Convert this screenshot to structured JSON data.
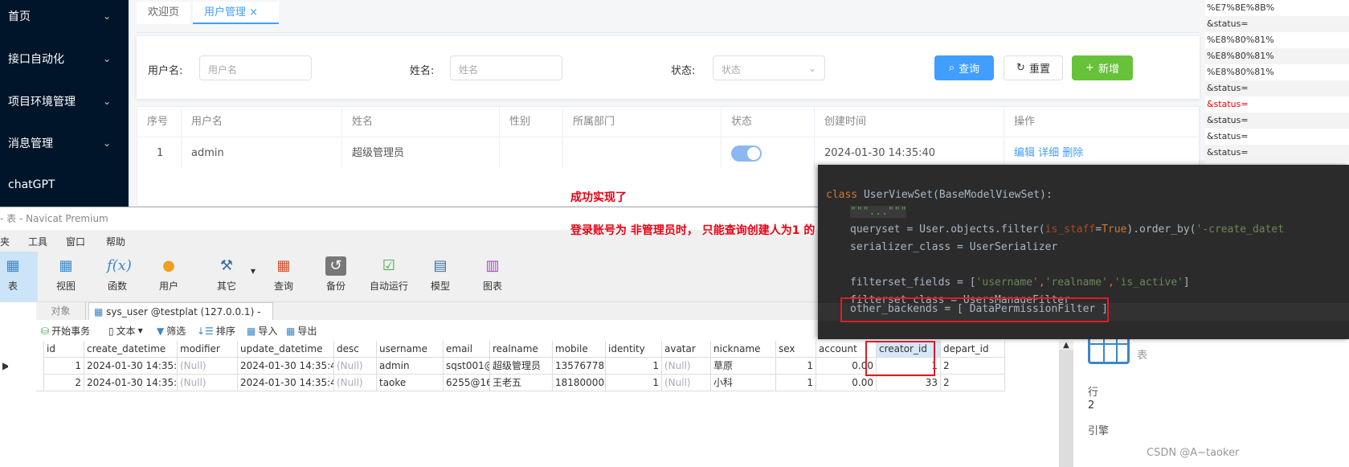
{
  "sidebar": {
    "items": [
      {
        "label": "首页"
      },
      {
        "label": "接口自动化"
      },
      {
        "label": "项目环境管理"
      },
      {
        "label": "消息管理"
      },
      {
        "label": "chatGPT"
      }
    ]
  },
  "web": {
    "tabs": [
      {
        "label": "欢迎页"
      },
      {
        "label": "用户管理",
        "close": "×"
      }
    ],
    "search": {
      "username_label": "用户名:",
      "username_placeholder": "用户名",
      "realname_label": "姓名:",
      "realname_placeholder": "姓名",
      "status_label": "状态:",
      "status_placeholder": "状态",
      "query": "查询",
      "reset": "重置",
      "add": "新增"
    },
    "table": {
      "headers": [
        "序号",
        "用户名",
        "姓名",
        "性别",
        "所属部门",
        "状态",
        "创建时间",
        "操作"
      ],
      "rows": [
        {
          "index": "1",
          "username": "admin",
          "realname": "超级管理员",
          "gender": "",
          "dept": "",
          "status_on": true,
          "created": "2024-01-30 14:35:40",
          "actions": [
            "编辑",
            "详细",
            "删除"
          ]
        }
      ]
    },
    "colors": {
      "primary": "#409eff",
      "success": "#67c23a"
    }
  },
  "url_log": [
    "%E7%8E%8B%",
    "&status=",
    "%E8%80%81%",
    "%E8%80%81%",
    "%E8%80%81%",
    "&status=",
    "&status=",
    "&status=",
    "&status=",
    "&status="
  ],
  "annotations": {
    "line1": "成功实现了",
    "line2": "登录账号为 非管理员时， 只能查询创建人为1 的"
  },
  "navicat": {
    "title": "- 表 - Navicat Premium",
    "menu": [
      "夹",
      "工具",
      "窗口",
      "帮助"
    ],
    "toolbar": [
      {
        "label": "表",
        "icon": "table-icon"
      },
      {
        "label": "视图",
        "icon": "view-icon"
      },
      {
        "label": "函数",
        "icon": "function-icon"
      },
      {
        "label": "用户",
        "icon": "user-icon"
      },
      {
        "label": "其它",
        "icon": "tools-icon"
      },
      {
        "label": "查询",
        "icon": "query-icon"
      },
      {
        "label": "备份",
        "icon": "backup-icon"
      },
      {
        "label": "自动运行",
        "icon": "schedule-icon"
      },
      {
        "label": "模型",
        "icon": "model-icon"
      },
      {
        "label": "图表",
        "icon": "chart-icon"
      }
    ],
    "tabs": {
      "objects": "对象",
      "table_tab": "sys_user @testplat (127.0.0.1) - 表"
    },
    "subtoolbar": {
      "begin_tx": "开始事务",
      "text": "文本",
      "filter": "筛选",
      "sort": "排序",
      "import": "导入",
      "export": "导出"
    },
    "grid": {
      "columns": [
        "id",
        "create_datetime",
        "modifier",
        "update_datetime",
        "desc",
        "username",
        "email",
        "realname",
        "mobile",
        "identity",
        "avatar",
        "nickname",
        "sex",
        "account",
        "creator_id",
        "depart_id"
      ],
      "rows": [
        [
          "1",
          "2024-01-30 14:35:40.",
          "(Null)",
          "2024-01-30 14:35:40.4",
          "(Null)",
          "admin",
          "sqst001@",
          "超级管理员",
          "1357677800",
          "1",
          "(Null)",
          "草原",
          "1",
          "0.00",
          "1",
          "2"
        ],
        [
          "2",
          "2024-01-30 14:35:40.",
          "(Null)",
          "2024-01-30 14:35:40.4",
          "(Null)",
          "taoke",
          "6255@163",
          "王老五",
          "1818000000",
          "1",
          "(Null)",
          "小科",
          "1",
          "0.00",
          "33",
          "2"
        ]
      ]
    },
    "info": {
      "type": "表",
      "rows_label": "行",
      "rows_value": "2",
      "engine_label": "引擎"
    }
  },
  "code": {
    "l1_kw": "class ",
    "l1_rest": "UserViewSet(BaseModelViewSet):",
    "l2": "\"\"\"...\"\"\"",
    "l3a": "queryset = User.objects.filter(",
    "l3b": "is_staff",
    "l3c": "=",
    "l3d": "True",
    ").order_by(": "",
    "l3e": ").order_by(",
    "l3f": "'-create_datet",
    "l4": "serializer_class = UserSerializer",
    "l5a": "filterset_fields = [",
    "l5b": "'username'",
    "l5c": ",",
    "l5d": "'realname'",
    "l5e": ",",
    "l5f": "'is_active'",
    "l5g": "]",
    "l6": "filterset_class = UsersManageFilter",
    "l7": "other_backends = [ DataPermissionFilter ]"
  },
  "watermark": "CSDN @A~taoker"
}
